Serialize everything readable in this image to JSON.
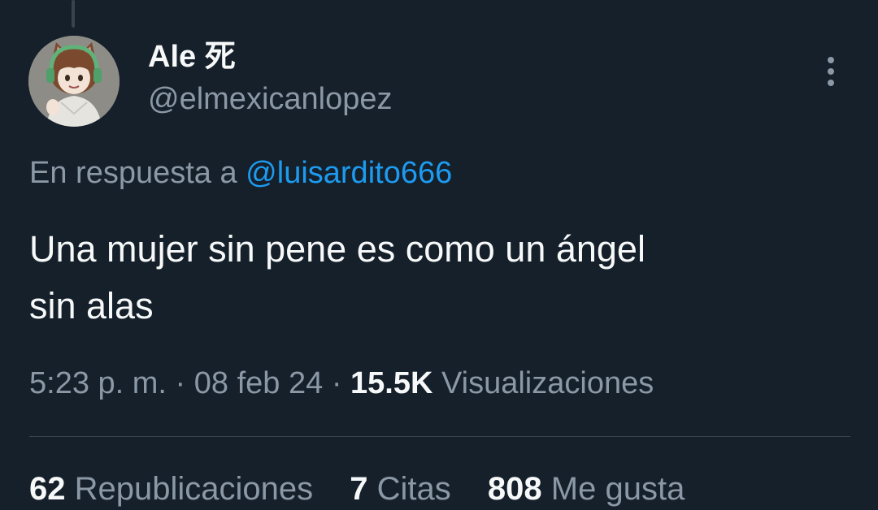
{
  "author": {
    "display_name": "Ale 死",
    "handle": "@elmexicanlopez"
  },
  "reply": {
    "prefix": "En respuesta a",
    "to_handle": "@luisardito666"
  },
  "tweet": {
    "text_line1": "Una mujer sin pene es como un ángel",
    "text_line2": "sin alas"
  },
  "meta": {
    "time": "5:23 p. m.",
    "separator": "·",
    "date": "08 feb 24",
    "views_count": "15.5K",
    "views_label": "Visualizaciones"
  },
  "stats": {
    "reposts_count": "62",
    "reposts_label": "Republicaciones",
    "quotes_count": "7",
    "quotes_label": "Citas",
    "likes_count": "808",
    "likes_label": "Me gusta"
  },
  "icons": {
    "more": "more-options-icon",
    "avatar": "avatar-image"
  },
  "colors": {
    "background": "#15202b",
    "primary_text": "#f7f9f9",
    "secondary_text": "#8b98a5",
    "link": "#1d9bf0"
  }
}
